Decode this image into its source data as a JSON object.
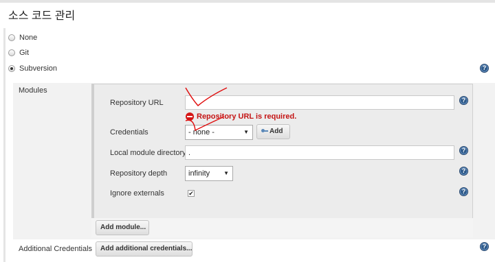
{
  "page": {
    "title": "소스 코드 관리"
  },
  "scm_options": [
    {
      "label": "None",
      "selected": false
    },
    {
      "label": "Git",
      "selected": false
    },
    {
      "label": "Subversion",
      "selected": true
    }
  ],
  "help_icon_glyph": "?",
  "modules": {
    "label": "Modules",
    "repository_url": {
      "label": "Repository URL",
      "value": ""
    },
    "error_message": "Repository URL is required.",
    "credentials": {
      "label": "Credentials",
      "selected": "- none -",
      "add_button": "Add"
    },
    "local_module_directory": {
      "label": "Local module directory",
      "value": "."
    },
    "repository_depth": {
      "label": "Repository depth",
      "selected": "infinity"
    },
    "ignore_externals": {
      "label": "Ignore externals",
      "checked": true,
      "check_glyph": "✔"
    },
    "add_module_button": "Add module..."
  },
  "additional_credentials": {
    "label": "Additional Credentials",
    "button": "Add additional credentials..."
  },
  "colors": {
    "error": "#c41414",
    "help_icon": "#2e5a8a",
    "annotation": "#e01010"
  }
}
